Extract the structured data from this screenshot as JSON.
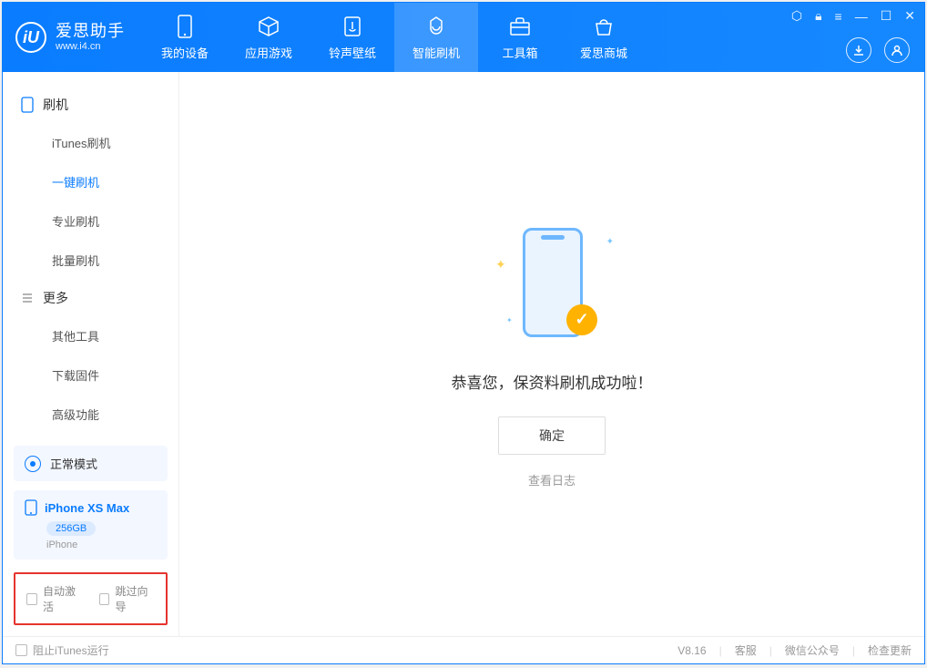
{
  "logo": {
    "title": "爱思助手",
    "subtitle": "www.i4.cn",
    "mark": "iU"
  },
  "nav": {
    "items": [
      {
        "label": "我的设备",
        "icon": "device-icon"
      },
      {
        "label": "应用游戏",
        "icon": "cube-icon"
      },
      {
        "label": "铃声壁纸",
        "icon": "ringtone-icon"
      },
      {
        "label": "智能刷机",
        "icon": "flash-icon"
      },
      {
        "label": "工具箱",
        "icon": "toolbox-icon"
      },
      {
        "label": "爱思商城",
        "icon": "store-icon"
      }
    ],
    "active_index": 3
  },
  "sidebar": {
    "sections": [
      {
        "header": "刷机",
        "items": [
          "iTunes刷机",
          "一键刷机",
          "专业刷机",
          "批量刷机"
        ],
        "active_index": 1
      },
      {
        "header": "更多",
        "items": [
          "其他工具",
          "下载固件",
          "高级功能"
        ],
        "active_index": -1
      }
    ],
    "mode_label": "正常模式",
    "device": {
      "name": "iPhone XS Max",
      "capacity": "256GB",
      "type": "iPhone"
    },
    "checkboxes": {
      "auto_activate": "自动激活",
      "skip_guide": "跳过向导"
    }
  },
  "main": {
    "success_message": "恭喜您，保资料刷机成功啦！",
    "ok_button": "确定",
    "view_log": "查看日志"
  },
  "footer": {
    "block_itunes": "阻止iTunes运行",
    "version": "V8.16",
    "links": [
      "客服",
      "微信公众号",
      "检查更新"
    ]
  },
  "colors": {
    "primary": "#0a7cff",
    "accent": "#ffb200"
  }
}
